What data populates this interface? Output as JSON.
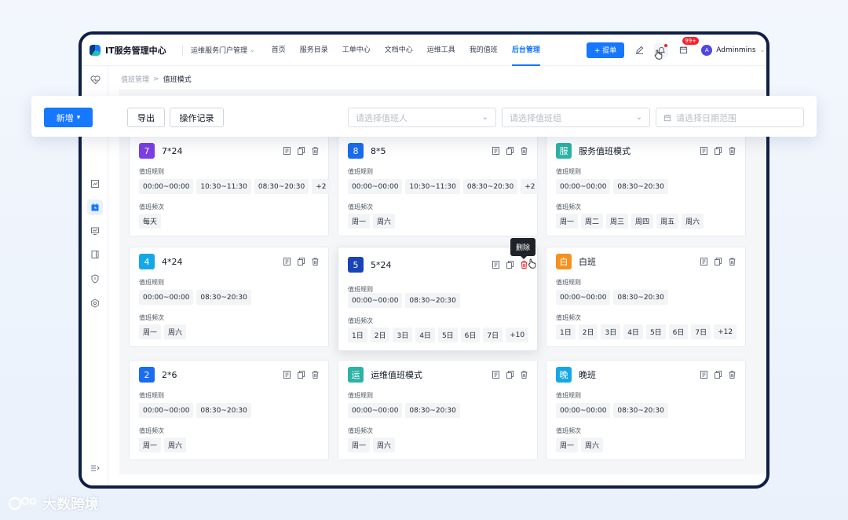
{
  "app": {
    "title": "IT服务管理中心",
    "portal": "运维服务门户管理",
    "nav": [
      "首页",
      "服务目录",
      "工单中心",
      "文档中心",
      "运维工具",
      "我的值班",
      "后台管理"
    ],
    "active_nav": "后台管理",
    "submit_label": "+ 提单",
    "badge": "99+",
    "user": "Adminmins",
    "avatar_letter": "A"
  },
  "breadcrumb": {
    "parent": "值班管理",
    "separator": ">",
    "current": "值班模式"
  },
  "toolbar": {
    "add_label": "新增",
    "export_label": "导出",
    "log_label": "操作记录",
    "person_placeholder": "请选择值班人",
    "group_placeholder": "请选择值班组",
    "date_placeholder": "请选择日期范围"
  },
  "labels": {
    "rule": "值班规则",
    "freq": "值班频次"
  },
  "tooltip": "删除",
  "cards": [
    {
      "icon": "7",
      "color": "#7b3fe4",
      "title": "7*24",
      "rules": [
        "00:00~00:00",
        "10:30~11:30",
        "08:30~20:30",
        "+2"
      ],
      "freq": [
        "每天"
      ]
    },
    {
      "icon": "8",
      "color": "#1a6cf0",
      "title": "8*5",
      "rules": [
        "00:00~00:00",
        "10:30~11:30",
        "08:30~20:30",
        "+2"
      ],
      "freq": [
        "周一",
        "周六"
      ]
    },
    {
      "icon": "服",
      "color": "#2bb3a4",
      "title": "服务值班模式",
      "rules": [
        "00:00~00:00",
        "08:30~20:30"
      ],
      "freq": [
        "周一",
        "周二",
        "周三",
        "周四",
        "周五",
        "周六"
      ]
    },
    {
      "icon": "4",
      "color": "#14a8e6",
      "title": "4*24",
      "rules": [
        "00:00~00:00",
        "08:30~20:30"
      ],
      "freq": [
        "周一",
        "周六"
      ]
    },
    {
      "icon": "5",
      "color": "#1944b8",
      "title": "5*24",
      "rules": [
        "00:00~00:00",
        "08:30~20:30"
      ],
      "freq": [
        "1日",
        "2日",
        "3日",
        "4日",
        "5日",
        "6日",
        "7日",
        "+10"
      ]
    },
    {
      "icon": "白",
      "color": "#f5911e",
      "title": "白班",
      "rules": [
        "00:00~00:00",
        "08:30~20:30"
      ],
      "freq": [
        "1日",
        "2日",
        "3日",
        "4日",
        "5日",
        "6日",
        "7日",
        "+12"
      ]
    },
    {
      "icon": "2",
      "color": "#1a6cf0",
      "title": "2*6",
      "rules": [
        "00:00~00:00",
        "08:30~20:30"
      ],
      "freq": [
        "周一",
        "周六"
      ]
    },
    {
      "icon": "运",
      "color": "#2bb3a4",
      "title": "运维值班模式",
      "rules": [
        "00:00~00:00",
        "08:30~20:30"
      ],
      "freq": [
        "周一",
        "周六"
      ]
    },
    {
      "icon": "晚",
      "color": "#14a8e6",
      "title": "晚班",
      "rules": [
        "00:00~00:00",
        "08:30~20:30"
      ],
      "freq": [
        "周一",
        "周六"
      ]
    }
  ],
  "watermark": "大数跨境"
}
